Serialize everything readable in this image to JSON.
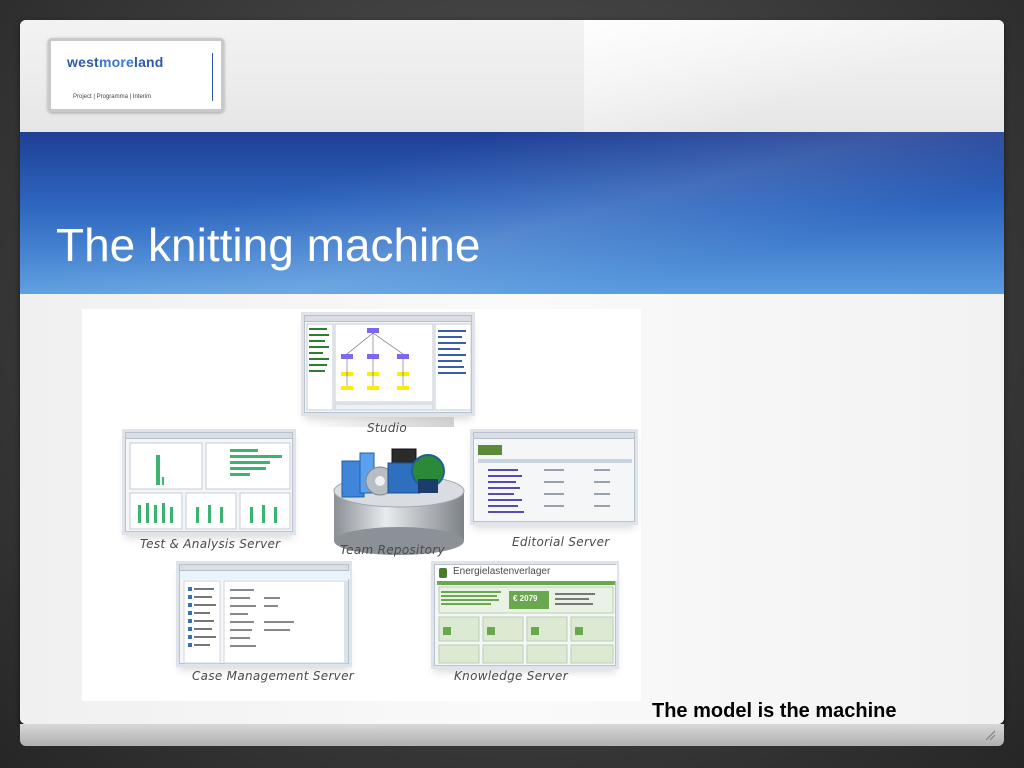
{
  "logo": {
    "word_part1": "west",
    "word_part2": "more",
    "word_part3": "land",
    "tagline": "Project | Programma | Interim"
  },
  "slide": {
    "title": "The knitting machine",
    "subtitle": "The model is the machine"
  },
  "diagram": {
    "captions": {
      "studio": "Studio",
      "test": "Test & Analysis Server",
      "repo": "Team Repository",
      "editorial": "Editorial Server",
      "case": "Case Management Server",
      "knowledge": "Knowledge Server"
    },
    "knowledge_header": "Energielastenverlager",
    "knowledge_amount": "€ 2079"
  },
  "colors": {
    "title_band": "#2e66bf",
    "logo_blue": "#2e5aa8",
    "chart_green": "#3cb371",
    "knowledge_green": "#6aa84f"
  }
}
